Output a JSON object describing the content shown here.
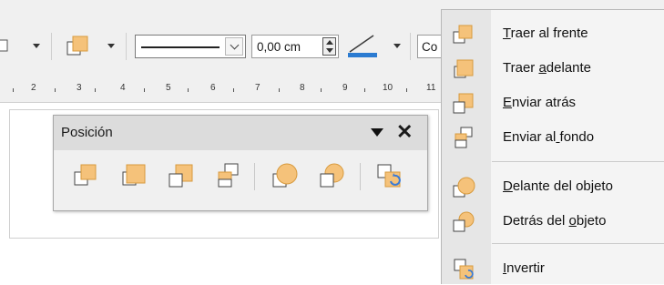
{
  "toolbar": {
    "line_width": "0,00 cm",
    "font_name_partial": "Co",
    "line_color": "#2b7bd1"
  },
  "ruler": {
    "numbers": [
      "2",
      "3",
      "4",
      "5",
      "6",
      "7",
      "8",
      "9",
      "10",
      "11"
    ]
  },
  "position_toolbar": {
    "title": "Posición",
    "buttons": [
      {
        "name": "bring-to-front"
      },
      {
        "name": "bring-forward"
      },
      {
        "name": "send-backward"
      },
      {
        "name": "send-to-back"
      },
      {
        "name": "in-front-of-object"
      },
      {
        "name": "behind-object"
      },
      {
        "name": "reverse"
      }
    ]
  },
  "context_menu": {
    "items": [
      {
        "label": "Traer al frente",
        "mnemonic_index": 0
      },
      {
        "label": "Traer adelante",
        "mnemonic_index": 6
      },
      {
        "label": "Enviar atrás",
        "mnemonic_index": 0
      },
      {
        "label": "Enviar al fondo",
        "mnemonic_index": 9
      },
      {
        "label": "Delante del objeto",
        "mnemonic_index": 0
      },
      {
        "label": "Detrás del objeto",
        "mnemonic_index": 11
      },
      {
        "label": "Invertir",
        "mnemonic_index": 0
      }
    ]
  },
  "colors": {
    "shape_fill": "#f5c27a",
    "shape_stroke": "#d79a3e",
    "outline": "#333333",
    "accent_blue": "#3a7bd5"
  }
}
